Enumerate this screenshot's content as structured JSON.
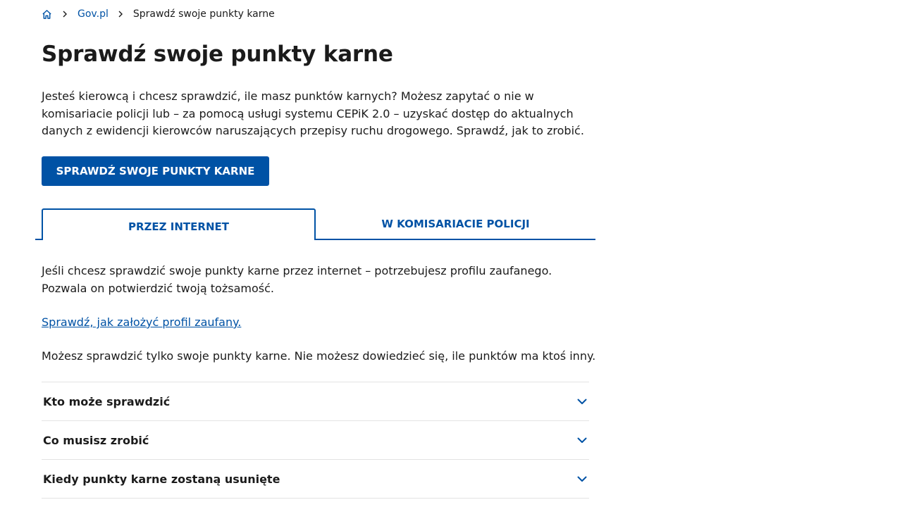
{
  "breadcrumb": {
    "home_icon": "home-icon",
    "separator_icon": "chevron-right-icon",
    "link_label": "Gov.pl",
    "current_label": "Sprawdź swoje punkty karne"
  },
  "page": {
    "title": "Sprawdź swoje punkty karne",
    "intro": "Jesteś kierowcą i chcesz sprawdzić, ile masz punktów karnych? Możesz zapytać o nie w komisariacie policji lub – za pomocą usługi systemu CEPiK 2.0 – uzyskać dostęp do aktualnych danych z ewidencji kierowców naruszających przepisy ruchu drogowego. Sprawdź, jak to zrobić.",
    "cta_label": "SPRAWDŹ SWOJE PUNKTY KARNE"
  },
  "tabs": [
    {
      "label": "PRZEZ INTERNET",
      "active": true
    },
    {
      "label": "W KOMISARIACIE POLICJI",
      "active": false
    }
  ],
  "tab_content": {
    "paragraph_1": "Jeśli chcesz sprawdzić swoje punkty karne przez internet – potrzebujesz profilu zaufanego. Pozwala on potwierdzić twoją tożsamość.",
    "link_label": "Sprawdź, jak założyć profil zaufany.",
    "paragraph_2": "Możesz sprawdzić tylko swoje punkty karne. Nie możesz dowiedzieć się, ile punktów ma ktoś inny."
  },
  "accordion": {
    "chevron_icon": "chevron-down-icon",
    "items": [
      {
        "label": "Kto może sprawdzić"
      },
      {
        "label": "Co musisz zrobić"
      },
      {
        "label": "Kiedy punkty karne zostaną usunięte"
      }
    ]
  },
  "colors": {
    "brand_blue": "#0052a5",
    "text": "#1b1b1b",
    "divider": "#e3e3e3"
  }
}
